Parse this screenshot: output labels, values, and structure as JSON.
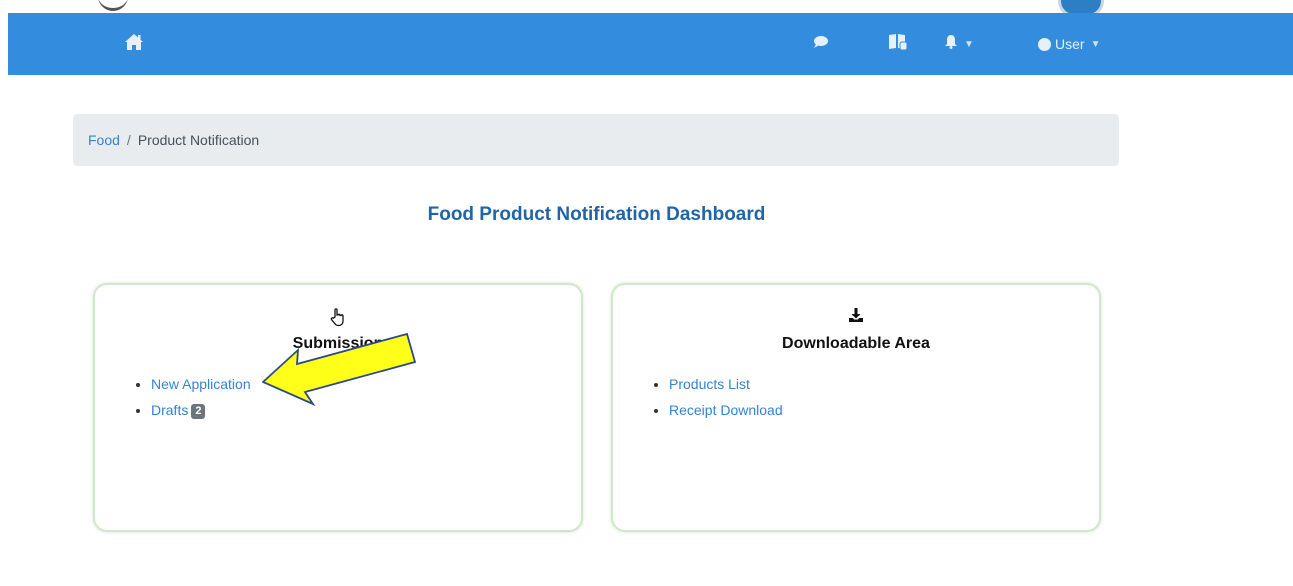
{
  "navbar": {
    "user_label": "User",
    "icons": [
      "home-icon",
      "chat-icon",
      "book-icon",
      "bell-icon",
      "user-circle-icon"
    ],
    "background": "#338cde"
  },
  "breadcrumb": {
    "root": "Food",
    "separator": "/",
    "current": "Product Notification"
  },
  "page": {
    "title": "Food Product Notification Dashboard"
  },
  "submission_card": {
    "title": "Submission",
    "icon": "hand-pointer-icon",
    "links": [
      {
        "label": "New Application"
      },
      {
        "label": "Drafts",
        "badge": "2"
      }
    ]
  },
  "download_card": {
    "title": "Downloadable Area",
    "icon": "download-icon",
    "links": [
      {
        "label": "Products List"
      },
      {
        "label": "Receipt Download"
      }
    ]
  },
  "annotation": {
    "arrow_color": "#ffff1a",
    "arrow_outline": "#2b4a8a"
  },
  "colors": {
    "accent": "#338cde",
    "link": "#3483d6",
    "title": "#1f65a8",
    "card_border": "#cde9c9"
  }
}
